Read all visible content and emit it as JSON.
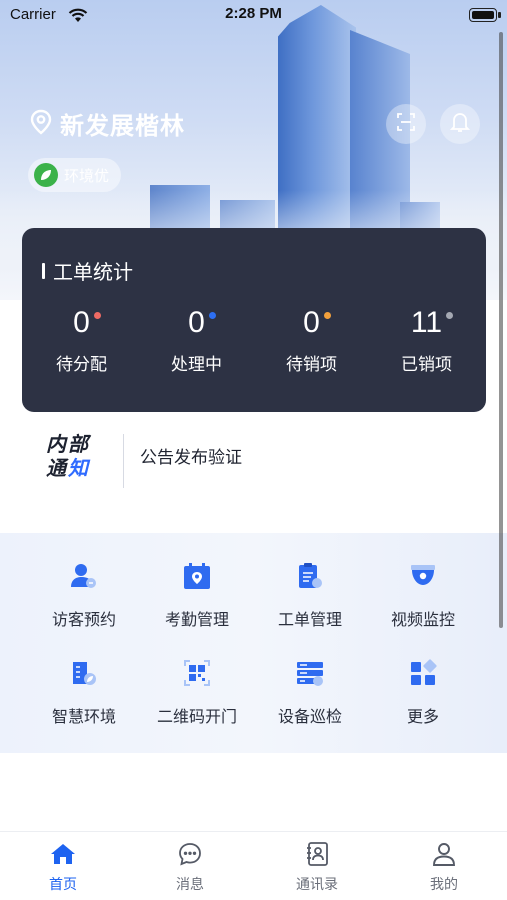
{
  "status_bar": {
    "carrier": "Carrier",
    "time": "2:28 PM"
  },
  "header": {
    "location": "新发展楷林",
    "environment_badge": "环境优"
  },
  "work_order_stats": {
    "title": "工单统计",
    "items": [
      {
        "value": "0",
        "label": "待分配",
        "dot_color": "#ee6a64"
      },
      {
        "value": "0",
        "label": "处理中",
        "dot_color": "#2d6ff3"
      },
      {
        "value": "0",
        "label": "待销项",
        "dot_color": "#f2a03c"
      },
      {
        "value": "11",
        "label": "已销项",
        "dot_color": "#a4a8b2"
      }
    ]
  },
  "notice": {
    "logo_line1": "内部",
    "logo_line2_a": "通",
    "logo_line2_b": "知",
    "text": "公告发布验证"
  },
  "grid": [
    {
      "label": "访客预约",
      "icon": "visitor-icon"
    },
    {
      "label": "考勤管理",
      "icon": "attendance-icon"
    },
    {
      "label": "工单管理",
      "icon": "work-order-icon"
    },
    {
      "label": "视频监控",
      "icon": "camera-icon"
    },
    {
      "label": "智慧环境",
      "icon": "environment-icon"
    },
    {
      "label": "二维码开门",
      "icon": "qrcode-icon"
    },
    {
      "label": "设备巡检",
      "icon": "device-inspection-icon"
    },
    {
      "label": "更多",
      "icon": "more-icon"
    }
  ],
  "tabs": [
    {
      "label": "首页",
      "icon": "home-icon",
      "active": true
    },
    {
      "label": "消息",
      "icon": "message-icon",
      "active": false
    },
    {
      "label": "通讯录",
      "icon": "contacts-icon",
      "active": false
    },
    {
      "label": "我的",
      "icon": "profile-icon",
      "active": false
    }
  ],
  "colors": {
    "accent": "#1e63f0",
    "card": "#2d3244",
    "icon_blue": "#2f6bf0"
  }
}
